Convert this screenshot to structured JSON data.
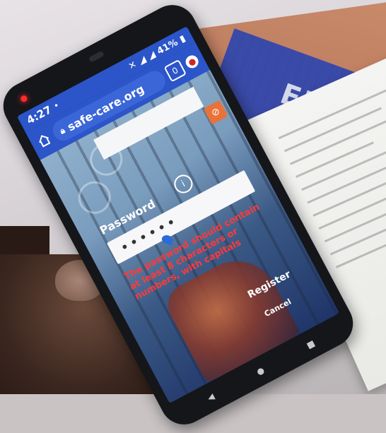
{
  "status_bar": {
    "time": "4:27",
    "dot": "•",
    "battery": "41%",
    "icons": [
      "mute-icon",
      "wifi-icon",
      "signal-icon",
      "signal-icon",
      "battery-icon"
    ]
  },
  "browser": {
    "url": "safe-care.org",
    "tab_count": "0",
    "menu_icon": "menu-icon"
  },
  "form": {
    "password_label": "Password",
    "info_symbol": "i",
    "password_value": "••••••",
    "error_message": "The password should contain at least 8 characters or numbers, with capitals",
    "register_label": "Register",
    "cancel_label": "Cancel"
  },
  "background": {
    "mat_text": "ENT"
  },
  "colors": {
    "browser_blue": "#2b55c9",
    "error_red": "#ff3a3a",
    "led_red": "#ff2a2a"
  }
}
